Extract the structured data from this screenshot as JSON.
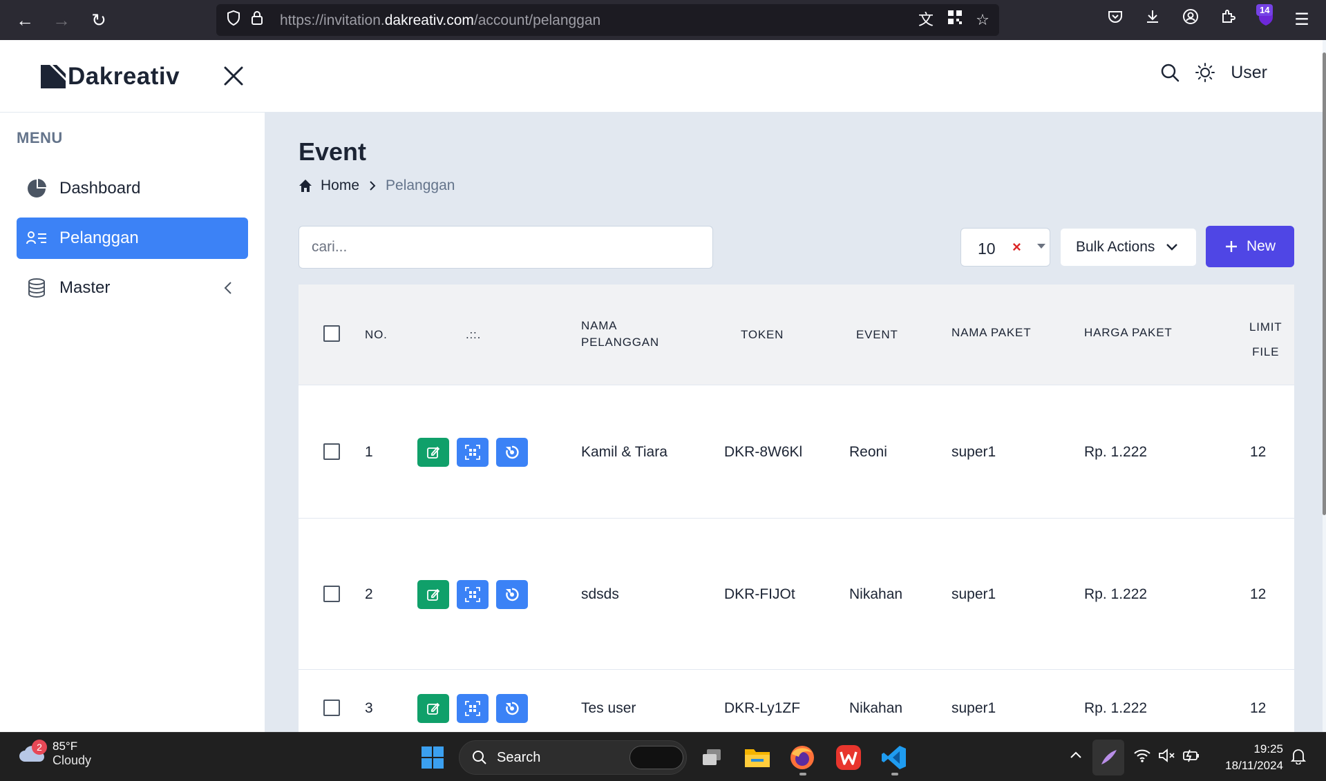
{
  "browser": {
    "url_prefix": "https://invitation.",
    "url_domain": "dakreativ.com",
    "url_path": "/account/pelanggan",
    "extensions_badge": "14"
  },
  "app": {
    "logo_text": "Dakreativ",
    "user_label": "User"
  },
  "sidebar": {
    "menu_heading": "MENU",
    "items": [
      {
        "label": "Dashboard",
        "icon": "pie-chart-icon",
        "active": false
      },
      {
        "label": "Pelanggan",
        "icon": "user-list-icon",
        "active": true
      },
      {
        "label": "Master",
        "icon": "database-icon",
        "active": false
      }
    ]
  },
  "page": {
    "title": "Event",
    "breadcrumb": {
      "home": "Home",
      "current": "Pelanggan"
    }
  },
  "toolbar": {
    "search_placeholder": "cari...",
    "per_page": "10",
    "clear_symbol": "×",
    "bulk_actions": "Bulk Actions",
    "new_label": "New"
  },
  "table": {
    "headers": {
      "no": "NO.",
      "actions": ".::.",
      "nama_pelanggan_1": "NAMA",
      "nama_pelanggan_2": "PELANGGAN",
      "token": "TOKEN",
      "event": "EVENT",
      "nama_paket": "NAMA PAKET",
      "harga_paket": "HARGA PAKET",
      "limit_1": "LIMIT",
      "limit_2": "FILE"
    },
    "rows": [
      {
        "no": "1",
        "nama": "Kamil & Tiara",
        "token": "DKR-8W6Kl",
        "event": "Reoni",
        "paket": "super1",
        "harga": "Rp. 1.222",
        "limit": "12"
      },
      {
        "no": "2",
        "nama": "sdsds",
        "token": "DKR-FIJOt",
        "event": "Nikahan",
        "paket": "super1",
        "harga": "Rp. 1.222",
        "limit": "12"
      },
      {
        "no": "3",
        "nama": "Tes user",
        "token": "DKR-Ly1ZF",
        "event": "Nikahan",
        "paket": "super1",
        "harga": "Rp. 1.222",
        "limit": "12"
      }
    ]
  },
  "taskbar": {
    "weather_temp": "85°F",
    "weather_cond": "Cloudy",
    "weather_badge": "2",
    "search_label": "Search",
    "time": "19:25",
    "date": "18/11/2024"
  }
}
